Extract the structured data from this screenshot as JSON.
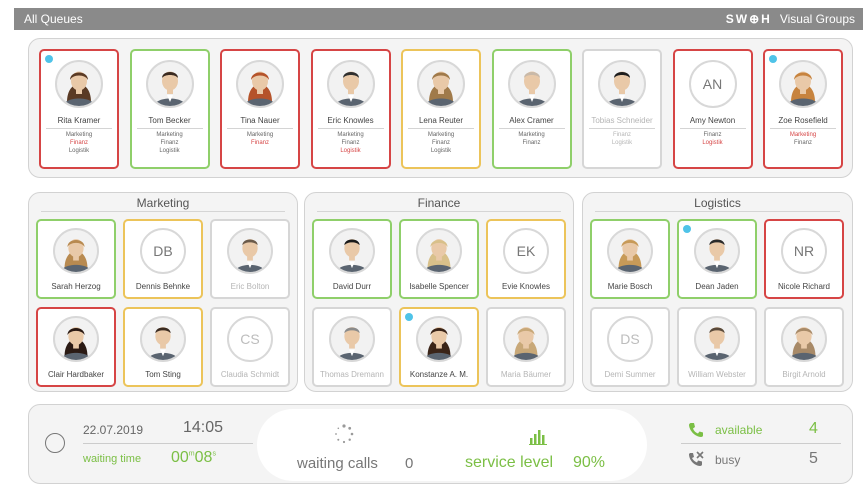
{
  "titlebar": {
    "title": "All Queues",
    "logo": "SW⊕H",
    "subtitle": "Visual Groups"
  },
  "queue": [
    {
      "name": "Rita Kramer",
      "status": "red",
      "dot": true,
      "tags": [
        {
          "t": "Marketing",
          "c": ""
        },
        {
          "t": "Finanz",
          "c": "red"
        },
        {
          "t": "Logistik",
          "c": ""
        }
      ],
      "avatar": "woman",
      "hair": "#5a3a24"
    },
    {
      "name": "Tom Becker",
      "status": "green",
      "dot": false,
      "tags": [
        {
          "t": "Marketing",
          "c": ""
        },
        {
          "t": "Finanz",
          "c": ""
        },
        {
          "t": "Logistik",
          "c": ""
        }
      ],
      "avatar": "man",
      "hair": "#3a2a20"
    },
    {
      "name": "Tina Nauer",
      "status": "red",
      "dot": false,
      "tags": [
        {
          "t": "Marketing",
          "c": ""
        },
        {
          "t": "Finanz",
          "c": "red"
        }
      ],
      "avatar": "woman",
      "hair": "#b5532a"
    },
    {
      "name": "Eric Knowles",
      "status": "red",
      "dot": false,
      "tags": [
        {
          "t": "Marketing",
          "c": ""
        },
        {
          "t": "Finanz",
          "c": ""
        },
        {
          "t": "Logistik",
          "c": "red"
        }
      ],
      "avatar": "man",
      "hair": "#2f2f2f"
    },
    {
      "name": "Lena Reuter",
      "status": "yellow",
      "dot": false,
      "tags": [
        {
          "t": "Marketing",
          "c": ""
        },
        {
          "t": "Finanz",
          "c": ""
        },
        {
          "t": "Logistik",
          "c": ""
        }
      ],
      "avatar": "woman",
      "hair": "#a07a4a"
    },
    {
      "name": "Alex Cramer",
      "status": "green",
      "dot": false,
      "tags": [
        {
          "t": "Marketing",
          "c": ""
        },
        {
          "t": "Finanz",
          "c": ""
        }
      ],
      "avatar": "man",
      "hair": "#c9b9a8"
    },
    {
      "name": "Tobias Schneider",
      "status": "grey",
      "dot": false,
      "tags": [
        {
          "t": "Finanz",
          "c": ""
        },
        {
          "t": "Logistik",
          "c": ""
        }
      ],
      "avatar": "man",
      "hair": "#1e1e1e"
    },
    {
      "name": "Amy Newton",
      "status": "red",
      "dot": false,
      "tags": [
        {
          "t": "Finanz",
          "c": ""
        },
        {
          "t": "Logistik",
          "c": "red"
        }
      ],
      "avatar": "AN",
      "hair": ""
    },
    {
      "name": "Zoe Rosefield",
      "status": "red",
      "dot": true,
      "tags": [
        {
          "t": "Marketing",
          "c": "red"
        },
        {
          "t": "Finanz",
          "c": ""
        }
      ],
      "avatar": "woman",
      "hair": "#c7833e"
    }
  ],
  "groups": [
    {
      "title": "Marketing",
      "members": [
        {
          "name": "Sarah Herzog",
          "status": "green",
          "dot": false,
          "avatar": "woman",
          "hair": "#b88a50"
        },
        {
          "name": "Dennis Behnke",
          "status": "yellow",
          "dot": false,
          "avatar": "DB",
          "hair": ""
        },
        {
          "name": "Eric Bolton",
          "status": "grey",
          "dot": false,
          "avatar": "man",
          "hair": "#6a5a4a"
        },
        {
          "name": "Clair Hardbaker",
          "status": "red",
          "dot": false,
          "avatar": "woman",
          "hair": "#2a1a14"
        },
        {
          "name": "Tom Sting",
          "status": "yellow",
          "dot": false,
          "avatar": "man",
          "hair": "#3a2a20"
        },
        {
          "name": "Claudia Schmidt",
          "status": "grey",
          "dot": false,
          "avatar": "CS",
          "hair": ""
        }
      ]
    },
    {
      "title": "Finance",
      "members": [
        {
          "name": "David Durr",
          "status": "green",
          "dot": false,
          "avatar": "man",
          "hair": "#1a1a1a"
        },
        {
          "name": "Isabelle Spencer",
          "status": "green",
          "dot": false,
          "avatar": "woman",
          "hair": "#d8c08a"
        },
        {
          "name": "Evie Knowles",
          "status": "yellow",
          "dot": false,
          "avatar": "EK",
          "hair": ""
        },
        {
          "name": "Thomas Dremann",
          "status": "grey",
          "dot": false,
          "avatar": "man",
          "hair": "#8a8a8a"
        },
        {
          "name": "Konstanze A. M.",
          "status": "yellow",
          "dot": true,
          "avatar": "woman",
          "hair": "#3a2418"
        },
        {
          "name": "Maria Bäumer",
          "status": "grey",
          "dot": false,
          "avatar": "woman",
          "hair": "#c8a878"
        }
      ]
    },
    {
      "title": "Logistics",
      "members": [
        {
          "name": "Marie Bosch",
          "status": "green",
          "dot": false,
          "avatar": "woman",
          "hair": "#c79a58"
        },
        {
          "name": "Dean Jaden",
          "status": "green",
          "dot": true,
          "avatar": "man",
          "hair": "#2a2a2a"
        },
        {
          "name": "Nicole Richard",
          "status": "red",
          "dot": false,
          "avatar": "NR",
          "hair": ""
        },
        {
          "name": "Demi Summer",
          "status": "grey",
          "dot": false,
          "avatar": "DS",
          "hair": ""
        },
        {
          "name": "William Webster",
          "status": "grey",
          "dot": false,
          "avatar": "man",
          "hair": "#5a4a3a"
        },
        {
          "name": "Birgit Arnold",
          "status": "grey",
          "dot": false,
          "avatar": "woman",
          "hair": "#a88a68"
        }
      ]
    }
  ],
  "status": {
    "date": "22.07.2019",
    "time": "14:05",
    "waiting_time_label": "waiting time",
    "waiting_time_min": "00",
    "waiting_time_min_unit": "m",
    "waiting_time_sec": "08",
    "waiting_time_sec_unit": "s",
    "waiting_calls_label": "waiting calls",
    "waiting_calls_value": "0",
    "service_level_label": "service level",
    "service_level_value": "90%",
    "available_label": "available",
    "available_value": "4",
    "busy_label": "busy",
    "busy_value": "5",
    "accent": "#7bbf45"
  }
}
